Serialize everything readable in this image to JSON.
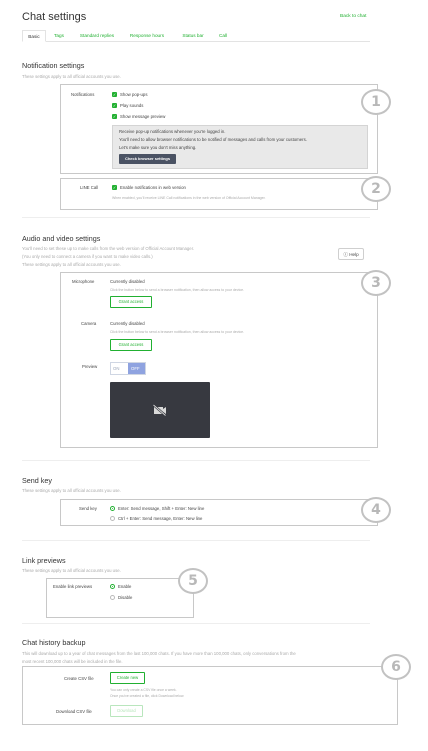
{
  "header": {
    "title": "Chat settings",
    "back_link": "Back to chat"
  },
  "tabs": [
    {
      "label": "Basic",
      "active": true
    },
    {
      "label": "Tags"
    },
    {
      "label": "Standard replies"
    },
    {
      "label": "Response hours"
    },
    {
      "label": "Status bar"
    },
    {
      "label": "Call"
    }
  ],
  "notification": {
    "title": "Notification settings",
    "desc": "These settings apply to all official accounts you use.",
    "label": "Notifications",
    "options": [
      "Show pop-ups",
      "Play sounds",
      "Show message preview"
    ],
    "info_lines": [
      "Receive pop-up notifications whenever you're logged in.",
      "You'll need to allow browser notifications to be notified of messages and calls from your customers.",
      "Let's make sure you don't miss anything."
    ],
    "check_button": "Check browser settings",
    "line_call_label": "LINE Call",
    "line_call_option": "Enable notifications in web version",
    "line_call_note": "When enabled, you'll receive LINE Call notifications in the web version of Official Account Manager.",
    "badge_1": "1",
    "badge_2": "2"
  },
  "audio": {
    "title": "Audio and video settings",
    "desc_lines": [
      "You'll need to set these up to make calls from the web version of Official Account Manager.",
      "(You only need to connect a camera if you want to make video calls.)",
      "These settings apply to all official accounts you use."
    ],
    "help_button": "Help",
    "microphone_label": "Microphone",
    "microphone_status": "Currently disabled",
    "microphone_note": "Click the button below to send a browser notification, then allow access to your device.",
    "camera_label": "Camera",
    "camera_status": "Currently disabled",
    "camera_note": "Click the button below to send a browser notification, then allow access to your device.",
    "grant_button": "Grant access",
    "preview_label": "Preview",
    "toggle_on": "ON",
    "toggle_off": "OFF",
    "badge": "3"
  },
  "send_key": {
    "title": "Send key",
    "desc": "These settings apply to all official accounts you use.",
    "label": "Send key",
    "options": [
      "Enter: Send message, Shift + Enter: New line",
      "Ctrl + Enter: Send message, Enter: New line"
    ],
    "selected": 0,
    "badge": "4"
  },
  "link_previews": {
    "title": "Link previews",
    "desc": "These settings apply to all official accounts you use.",
    "label": "Enable link previews",
    "options": [
      "Enable",
      "Disable"
    ],
    "selected": 0,
    "badge": "5"
  },
  "chat_history": {
    "title": "Chat history backup",
    "desc_lines": [
      "This will download up to a year of chat messages from the last 100,000 chats. If you have more than 100,000 chats, only conversations from the",
      "most recent 100,000 chats will be included in the file."
    ],
    "create_label": "Create CSV file",
    "create_button": "Create new",
    "create_notes": [
      "You can only create a CSV file once a week.",
      "Once you've created a file, click Download below."
    ],
    "download_label": "Download CSV file",
    "download_button": "Download",
    "badge": "6"
  },
  "colors": {
    "accent": "#21b031",
    "border": "#c8c8c8",
    "video_bg": "#373940"
  }
}
